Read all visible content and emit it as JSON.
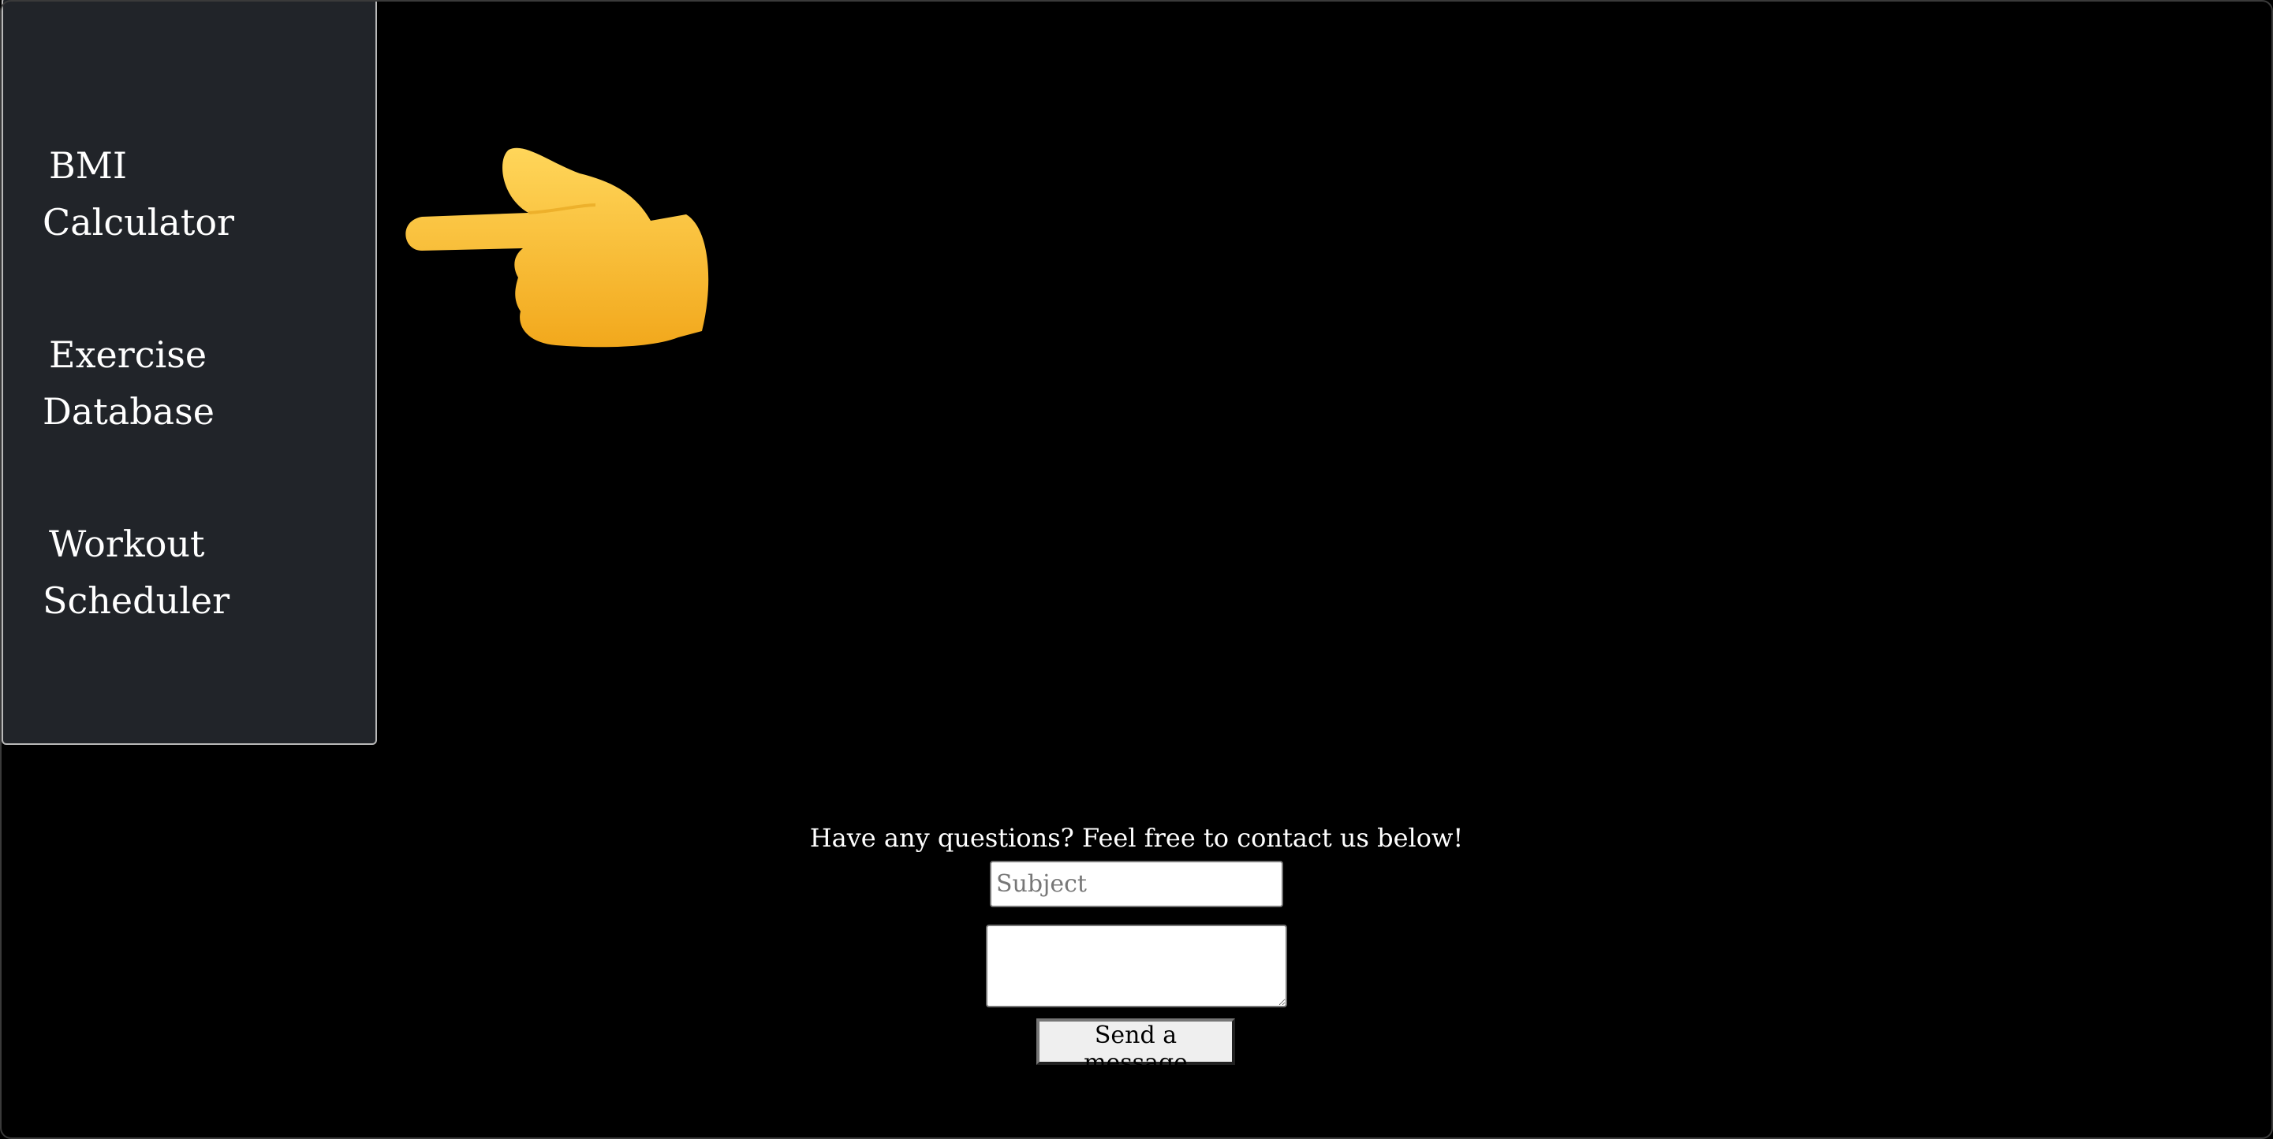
{
  "sidebar": {
    "items": [
      {
        "line1": "BMI",
        "line2": "Calculator"
      },
      {
        "line1": "Exercise",
        "line2": "Database"
      },
      {
        "line1": "Workout",
        "line2": "Scheduler"
      }
    ]
  },
  "pointer": {
    "icon": "pointing-left-hand-icon",
    "color": "#F9C22E"
  },
  "contact": {
    "prompt": "Have any questions? Feel free to contact us below!",
    "subject_placeholder": "Subject",
    "message_value": "",
    "send_label": "Send a message"
  }
}
